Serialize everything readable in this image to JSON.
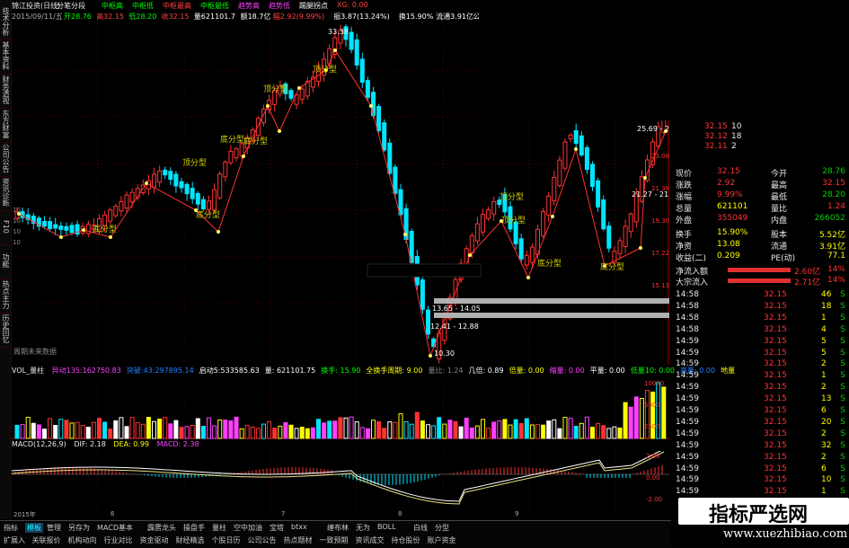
{
  "header": {
    "title": "锦江投资(日线)",
    "mode": "分笔分段",
    "ma_labels": [
      {
        "text": "中枢高",
        "color": "#00ff00"
      },
      {
        "text": "中枢低",
        "color": "#00ff00"
      },
      {
        "text": "中枢最高",
        "color": "#ff4040"
      },
      {
        "text": "中枢最低",
        "color": "#00ff00"
      },
      {
        "text": "趋势高",
        "color": "#ff40ff"
      },
      {
        "text": "趋势低",
        "color": "#ff40ff"
      },
      {
        "text": "踢腿拐点",
        "color": "#ffffff"
      },
      {
        "text": "XG: 0.00",
        "color": "#ff4040"
      }
    ],
    "date": "2015/09/11/五",
    "ohlc": [
      {
        "text": "开28.76",
        "color": "#00ff00"
      },
      {
        "text": "高32.15",
        "color": "#ff4040"
      },
      {
        "text": "低28.20",
        "color": "#00ff00"
      },
      {
        "text": "收32.15",
        "color": "#ff4040"
      },
      {
        "text": "量621101.7",
        "color": "#ffffff"
      },
      {
        "text": "额18.7亿",
        "color": "#ffffff"
      },
      {
        "text": "幅2.92(9.99%)",
        "color": "#ff4040"
      },
      {
        "text": "振3.87(13.24%)",
        "color": "#ffffff"
      },
      {
        "text": "换15.90%",
        "color": "#ffffff"
      },
      {
        "text": "流通3.91亿",
        "color": "#ffffff"
      },
      {
        "text": "公共交通",
        "color": "#ffffff"
      }
    ]
  },
  "vertical_tabs": [
    "技术分析",
    "基本资料",
    "财务透视",
    "东方财富",
    "公司公告",
    "资讯诊断",
    "F10",
    "功能",
    "热点主力",
    "历史回忆"
  ],
  "chart": {
    "price_labels": {
      "top_high": "33.38",
      "low_value": "10.30",
      "band1": "12.41 - 12.88",
      "band2": "13.65 - 14.05",
      "band3": "21.27 - 21.33",
      "recent_high": "25.69 - 27."
    },
    "pattern_labels": [
      "顶分型",
      "底分型",
      "顶分型",
      "底分型",
      "顶分型",
      "底分型",
      "顶分型",
      "底分型",
      "顶分型",
      "底分型",
      "底分型"
    ],
    "left_axis": [
      "10",
      "10",
      "10",
      "10"
    ],
    "right_axis": [
      "23.08",
      "21.38",
      "19.30",
      "17.22",
      "15.13"
    ],
    "corner_note": "周期未来数据"
  },
  "volume": {
    "label": "VOL_量柱",
    "items": [
      {
        "text": "异动135:162750.83",
        "color": "#ff40ff"
      },
      {
        "text": "突破:43:297895.14",
        "color": "#2080ff"
      },
      {
        "text": "启动5:533585.63",
        "color": "#ffffff"
      },
      {
        "text": "量: 621101.75",
        "color": "#ffffff"
      },
      {
        "text": "换手: 15.90",
        "color": "#00ff00"
      },
      {
        "text": "全换手周期: 9.00",
        "color": "#ffff00"
      },
      {
        "text": "量比: 1.24",
        "color": "#888888"
      },
      {
        "text": "几倍: 0.89",
        "color": "#ffffff"
      },
      {
        "text": "倍量: 0.00",
        "color": "#ffff00"
      },
      {
        "text": "缩量: 0.00",
        "color": "#ff40ff"
      },
      {
        "text": "平量: 0.00",
        "color": "#ffffff"
      },
      {
        "text": "低量10: 0.00",
        "color": "#00ff00"
      },
      {
        "text": "高量: 0.00",
        "color": "#2080ff"
      },
      {
        "text": "地量",
        "color": "#ffff00"
      }
    ],
    "axis": [
      "10000",
      "5000",
      "2500"
    ]
  },
  "macd": {
    "label": "MACD(12,26,9)",
    "dif": "DIF: 2.18",
    "dea": "DEA: 0.99",
    "macd": "MACD: 2.38",
    "axis": [
      "2.00",
      "0.00",
      "-2.00"
    ]
  },
  "date_axis": [
    "2015年",
    "6",
    "7",
    "8",
    "9"
  ],
  "bottom_tabs": [
    {
      "text": "指标",
      "active": false
    },
    {
      "text": "模板",
      "active": true
    },
    {
      "text": "管理",
      "active": false
    },
    {
      "text": "另存为",
      "active": false
    },
    {
      "text": "MACD基本",
      "active": false
    },
    {
      "text": "霹雳龙头",
      "active": false
    },
    {
      "text": "操盘手",
      "active": false
    },
    {
      "text": "量柱",
      "active": false
    },
    {
      "text": "空中加油",
      "active": false
    },
    {
      "text": "宝塔",
      "active": false
    },
    {
      "text": "btxx",
      "active": false
    },
    {
      "text": "缠布林",
      "active": false
    },
    {
      "text": "无为",
      "active": false
    },
    {
      "text": "BOLL",
      "active": false
    },
    {
      "text": "白线",
      "active": false
    },
    {
      "text": "分型",
      "active": false
    }
  ],
  "bottom_row2": [
    "扩展入",
    "关联报价",
    "机构动向",
    "行业对比",
    "资金驱动",
    "财经精选",
    "个股日历",
    "公司公告",
    "热点题材",
    "一致预期",
    "资讯成交",
    "持仓股份",
    "账户资金"
  ],
  "quote_top": [
    {
      "price": "32.15",
      "vol": "10"
    },
    {
      "price": "32.12",
      "vol": "18"
    },
    {
      "price": "32.11",
      "vol": "2"
    }
  ],
  "quote": [
    {
      "l": "现价",
      "lv": "32.15",
      "lc": "#ff3232",
      "r": "今开",
      "rv": "28.76",
      "rc": "#00d000"
    },
    {
      "l": "涨跌",
      "lv": "2.92",
      "lc": "#ff3232",
      "r": "最高",
      "rv": "32.15",
      "rc": "#ff3232"
    },
    {
      "l": "涨幅",
      "lv": "9.99%",
      "lc": "#ff3232",
      "r": "最低",
      "rv": "28.20",
      "rc": "#00d000"
    },
    {
      "l": "总量",
      "lv": "621101",
      "lc": "#ffff00",
      "r": "量比",
      "rv": "1.24",
      "rc": "#ff3232"
    },
    {
      "l": "外盘",
      "lv": "355049",
      "lc": "#ff3232",
      "r": "内盘",
      "rv": "266052",
      "rc": "#00d000"
    },
    {
      "l": "换手",
      "lv": "15.90%",
      "lc": "#ffff00",
      "r": "股本",
      "rv": "5.52亿",
      "rc": "#ffff00"
    },
    {
      "l": "净资",
      "lv": "13.08",
      "lc": "#ffff00",
      "r": "流通",
      "rv": "3.91亿",
      "rc": "#ffff00"
    },
    {
      "l": "收益(二)",
      "lv": "0.209",
      "lc": "#ffff00",
      "r": "PE(动)",
      "rv": "77.1",
      "rc": "#ffff00"
    }
  ],
  "flow": [
    {
      "label": "净流入额",
      "value": "2.60亿",
      "pct": "14%"
    },
    {
      "label": "大宗流入",
      "value": "2.71亿",
      "pct": "14%"
    }
  ],
  "ticks": [
    {
      "time": "14:58",
      "price": "32.15",
      "vol": "46",
      "side": "S"
    },
    {
      "time": "14:58",
      "price": "32.15",
      "vol": "18",
      "side": "S"
    },
    {
      "time": "14:58",
      "price": "32.15",
      "vol": "1",
      "side": "S"
    },
    {
      "time": "14:58",
      "price": "32.15",
      "vol": "4",
      "side": "S"
    },
    {
      "time": "14:59",
      "price": "32.15",
      "vol": "5",
      "side": "S"
    },
    {
      "time": "14:59",
      "price": "32.15",
      "vol": "5",
      "side": "S"
    },
    {
      "time": "14:59",
      "price": "32.15",
      "vol": "2",
      "side": "S"
    },
    {
      "time": "14:59",
      "price": "32.15",
      "vol": "1",
      "side": "S"
    },
    {
      "time": "14:59",
      "price": "32.15",
      "vol": "2",
      "side": "S"
    },
    {
      "time": "14:59",
      "price": "32.15",
      "vol": "13",
      "side": "S"
    },
    {
      "time": "14:59",
      "price": "32.15",
      "vol": "6",
      "side": "S"
    },
    {
      "time": "14:59",
      "price": "32.15",
      "vol": "20",
      "side": "S"
    },
    {
      "time": "14:59",
      "price": "32.15",
      "vol": "2",
      "side": "S"
    },
    {
      "time": "14:59",
      "price": "32.15",
      "vol": "32",
      "side": "S"
    },
    {
      "time": "14:59",
      "price": "32.15",
      "vol": "2",
      "side": "S"
    },
    {
      "time": "14:59",
      "price": "32.15",
      "vol": "6",
      "side": "S"
    },
    {
      "time": "14:59",
      "price": "32.15",
      "vol": "10",
      "side": "S"
    },
    {
      "time": "14:59",
      "price": "32.15",
      "vol": "1",
      "side": "S"
    }
  ],
  "watermark": {
    "title": "指标严选网",
    "url": "www.xuezhibiao.com"
  },
  "colors": {
    "up": "#ff3232",
    "down": "#00e5ff",
    "bg": "#000000",
    "grid": "#5a0000",
    "trend_line": "#ff3030",
    "pattern_text": "#d0d000"
  }
}
